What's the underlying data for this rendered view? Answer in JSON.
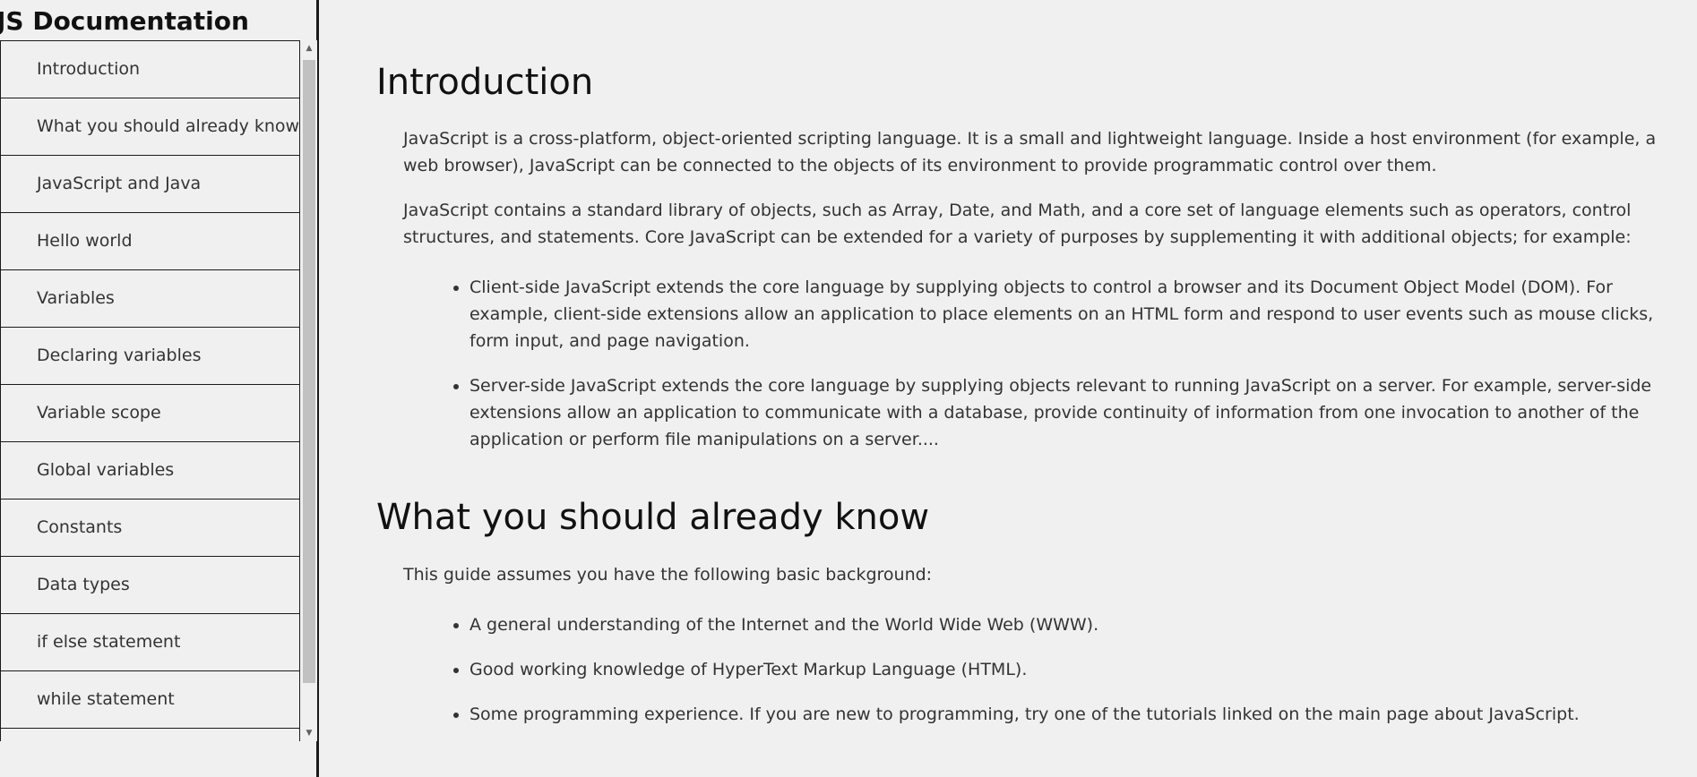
{
  "navbar": {
    "header": "JS Documentation",
    "links": [
      "Introduction",
      "What you should already know",
      "JavaScript and Java",
      "Hello world",
      "Variables",
      "Declaring variables",
      "Variable scope",
      "Global variables",
      "Constants",
      "Data types",
      "if else statement",
      "while statement"
    ]
  },
  "main": {
    "sections": [
      {
        "title": "Introduction",
        "paragraphs": [
          "JavaScript is a cross-platform, object-oriented scripting language. It is a small and lightweight language. Inside a host environment (for example, a web browser), JavaScript can be connected to the objects of its environment to provide programmatic control over them.",
          "JavaScript contains a standard library of objects, such as Array, Date, and Math, and a core set of language elements such as operators, control structures, and statements. Core JavaScript can be extended for a variety of purposes by supplementing it with additional objects; for example:"
        ],
        "bullets": [
          "Client-side JavaScript extends the core language by supplying objects to control a browser and its Document Object Model (DOM). For example, client-side extensions allow an application to place elements on an HTML form and respond to user events such as mouse clicks, form input, and page navigation.",
          "Server-side JavaScript extends the core language by supplying objects relevant to running JavaScript on a server. For example, server-side extensions allow an application to communicate with a database, provide continuity of information from one invocation to another of the application or perform file manipulations on a server...."
        ]
      },
      {
        "title": "What you should already know",
        "paragraphs": [
          "This guide assumes you have the following basic background:"
        ],
        "bullets": [
          "A general understanding of the Internet and the World Wide Web (WWW).",
          "Good working knowledge of HyperText Markup Language (HTML).",
          "Some programming experience. If you are new to programming, try one of the tutorials linked on the main page about JavaScript."
        ]
      }
    ]
  }
}
